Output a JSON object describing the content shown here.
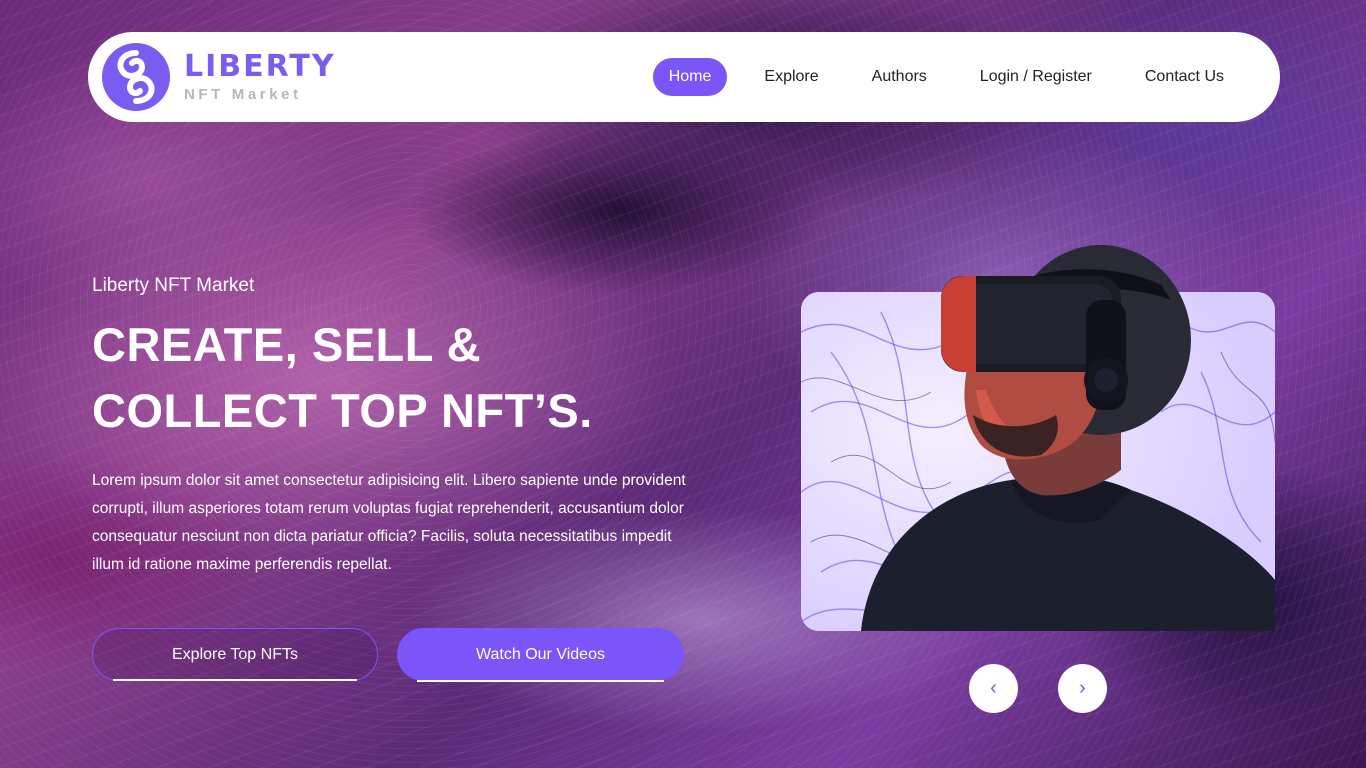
{
  "brand": {
    "title": "LIBERTY",
    "subtitle": "NFT Market",
    "accent_color": "#7b55f8",
    "logo_icon": "liberty-swirl-logo"
  },
  "nav": {
    "items": [
      {
        "label": "Home",
        "active": true
      },
      {
        "label": "Explore",
        "active": false
      },
      {
        "label": "Authors",
        "active": false
      },
      {
        "label": "Login / Register",
        "active": false
      },
      {
        "label": "Contact Us",
        "active": false
      }
    ]
  },
  "hero": {
    "eyebrow": "Liberty NFT Market",
    "headline_line1": "CREATE, SELL &",
    "headline_line2": "COLLECT TOP NFT’S.",
    "description": "Lorem ipsum dolor sit amet consectetur adipisicing elit. Libero sapiente unde provident corrupti, illum asperiores totam rerum voluptas fugiat reprehenderit, accusantium dolor consequatur nesciunt non dicta pariatur officia? Facilis, soluta necessitatibus impedit illum id ratione maxime perferendis repellat.",
    "primary_button": "Explore Top NFTs",
    "secondary_button": "Watch Our Videos"
  },
  "carousel": {
    "prev_icon": "chevron-left-icon",
    "next_icon": "chevron-right-icon",
    "prev_glyph": "‹",
    "next_glyph": "›"
  }
}
